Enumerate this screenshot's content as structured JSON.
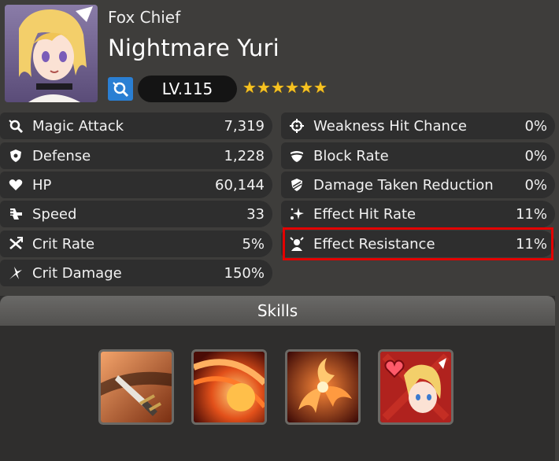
{
  "hero": {
    "title": "Fox Chief",
    "name": "Nightmare Yuri",
    "level": "LV.115",
    "stars": 6,
    "class_icon": "mage-class-icon",
    "portrait": "hero-portrait"
  },
  "stats_left": [
    {
      "icon": "magic-attack-icon",
      "label": "Magic Attack",
      "value": "7,319"
    },
    {
      "icon": "defense-icon",
      "label": "Defense",
      "value": "1,228"
    },
    {
      "icon": "heart-icon",
      "label": "HP",
      "value": "60,144"
    },
    {
      "icon": "speed-icon",
      "label": "Speed",
      "value": "33"
    },
    {
      "icon": "crit-rate-icon",
      "label": "Crit Rate",
      "value": "5%"
    },
    {
      "icon": "crit-damage-icon",
      "label": "Crit Damage",
      "value": "150%"
    }
  ],
  "stats_right": [
    {
      "icon": "crosshair-icon",
      "label": "Weakness Hit Chance",
      "value": "0%"
    },
    {
      "icon": "block-icon",
      "label": "Block Rate",
      "value": "0%"
    },
    {
      "icon": "damage-reduction-icon",
      "label": "Damage Taken Reduction",
      "value": "0%"
    },
    {
      "icon": "effect-hit-icon",
      "label": "Effect Hit Rate",
      "value": "11%"
    },
    {
      "icon": "effect-resistance-icon",
      "label": "Effect Resistance",
      "value": "11%"
    }
  ],
  "skills": {
    "header": "Skills",
    "items": [
      "dagger-skill-icon",
      "fire-slash-skill-icon",
      "fire-burst-skill-icon",
      "heart-portrait-skill-icon"
    ]
  },
  "colors": {
    "highlight": "#e30000",
    "star": "#f6c221",
    "class_badge": "#2a7fd3"
  }
}
